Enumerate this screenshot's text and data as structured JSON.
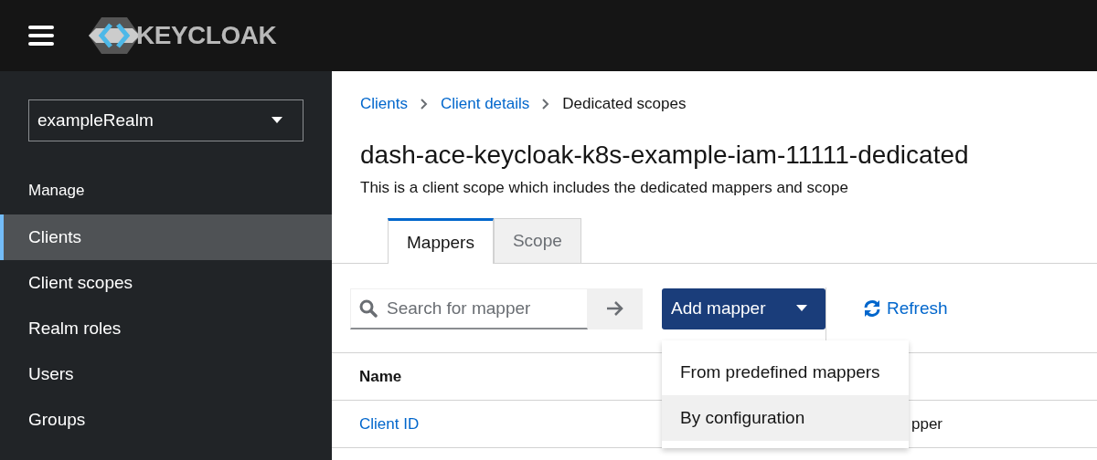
{
  "header": {
    "logo_text": "KEYCLOAK"
  },
  "sidebar": {
    "realm_select": {
      "value": "exampleRealm"
    },
    "section": "Manage",
    "items": [
      {
        "label": "Clients",
        "selected": true
      },
      {
        "label": "Client scopes",
        "selected": false
      },
      {
        "label": "Realm roles",
        "selected": false
      },
      {
        "label": "Users",
        "selected": false
      },
      {
        "label": "Groups",
        "selected": false
      }
    ]
  },
  "breadcrumb": [
    {
      "label": "Clients",
      "link": true
    },
    {
      "label": "Client details",
      "link": true
    },
    {
      "label": "Dedicated scopes",
      "link": false
    }
  ],
  "page": {
    "title": "dash-ace-keycloak-k8s-example-iam-11111-dedicated",
    "subtitle": "This is a client scope which includes the dedicated mappers and scope"
  },
  "tabs": [
    {
      "label": "Mappers",
      "selected": true
    },
    {
      "label": "Scope",
      "selected": false
    }
  ],
  "toolbar": {
    "search": {
      "placeholder": "Search for mapper"
    },
    "add_button": "Add mapper",
    "refresh": "Refresh"
  },
  "dropdown_menu": [
    {
      "label": "From predefined mappers",
      "hovered": false
    },
    {
      "label": "By configuration",
      "hovered": true
    }
  ],
  "table": {
    "columns": [
      "Name"
    ],
    "rows": [
      {
        "name": "Client ID",
        "column_2": "pper"
      }
    ]
  }
}
